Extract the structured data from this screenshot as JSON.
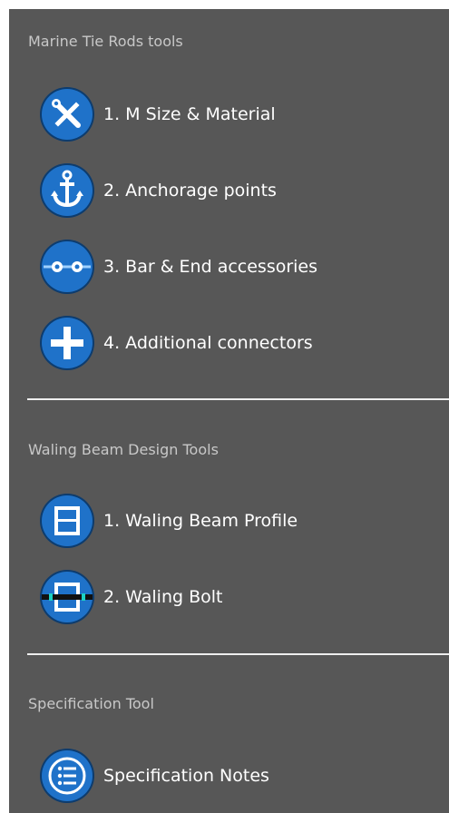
{
  "sections": [
    {
      "title": "Marine Tie Rods tools",
      "items": [
        {
          "label": "1. M Size & Material",
          "icon": "tools-icon"
        },
        {
          "label": "2. Anchorage points",
          "icon": "anchor-icon"
        },
        {
          "label": "3. Bar & End accessories",
          "icon": "tie-bar-icon"
        },
        {
          "label": "4. Additional connectors",
          "icon": "plus-icon"
        }
      ]
    },
    {
      "title": "Waling Beam Design Tools",
      "items": [
        {
          "label": "1. Waling Beam Profile",
          "icon": "i-beam-icon"
        },
        {
          "label": "2. Waling Bolt",
          "icon": "waling-bolt-icon"
        }
      ]
    },
    {
      "title": "Specification Tool",
      "items": [
        {
          "label": "Specification Notes",
          "icon": "list-icon"
        }
      ]
    }
  ],
  "colors": {
    "panel_background": "#575757",
    "icon_blue": "#1f72c9",
    "icon_dark": "#0d3c6e",
    "section_title": "#c8c8c8",
    "label_text": "#ffffff",
    "divider": "#eeeeee",
    "bolt_accent": "#1bd1c4"
  }
}
